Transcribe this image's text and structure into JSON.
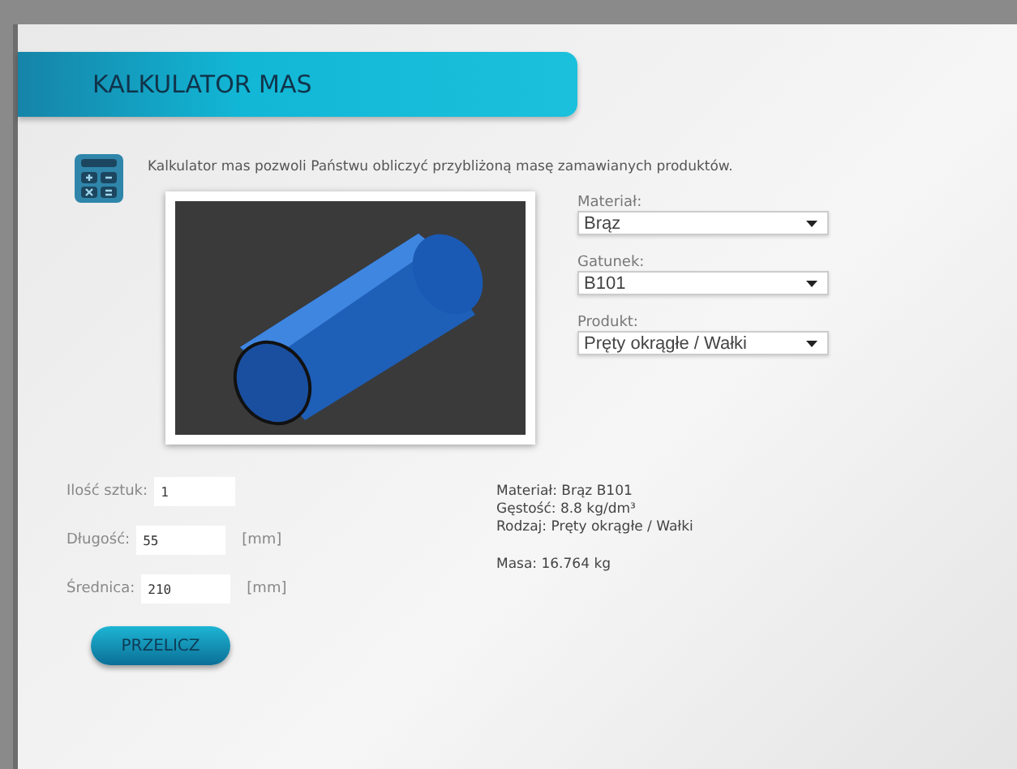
{
  "header": {
    "title": "KALKULATOR MAS"
  },
  "description": "Kalkulator mas pozwoli Państwu obliczyć przybliżoną masę zamawianych produktów.",
  "selects": [
    {
      "label": "Materiał:",
      "value": "Brąz"
    },
    {
      "label": "Gatunek:",
      "value": "B101"
    },
    {
      "label": "Produkt:",
      "value": "Pręty okrągłe / Wałki"
    }
  ],
  "fields": [
    {
      "label": "Ilość sztuk:",
      "value": "1"
    },
    {
      "label": "Długość:",
      "value": "55",
      "unit": "[mm]"
    },
    {
      "label": "Średnica:",
      "value": "210",
      "unit": "[mm]"
    }
  ],
  "button": "PRZELICZ",
  "results": [
    "Materiał: Brąz B101",
    "Gęstość: 8.8 kg/dm³",
    "Rodzaj: Pręty okrągłe / Wałki"
  ],
  "mass": "Masa: 16.764 kg"
}
